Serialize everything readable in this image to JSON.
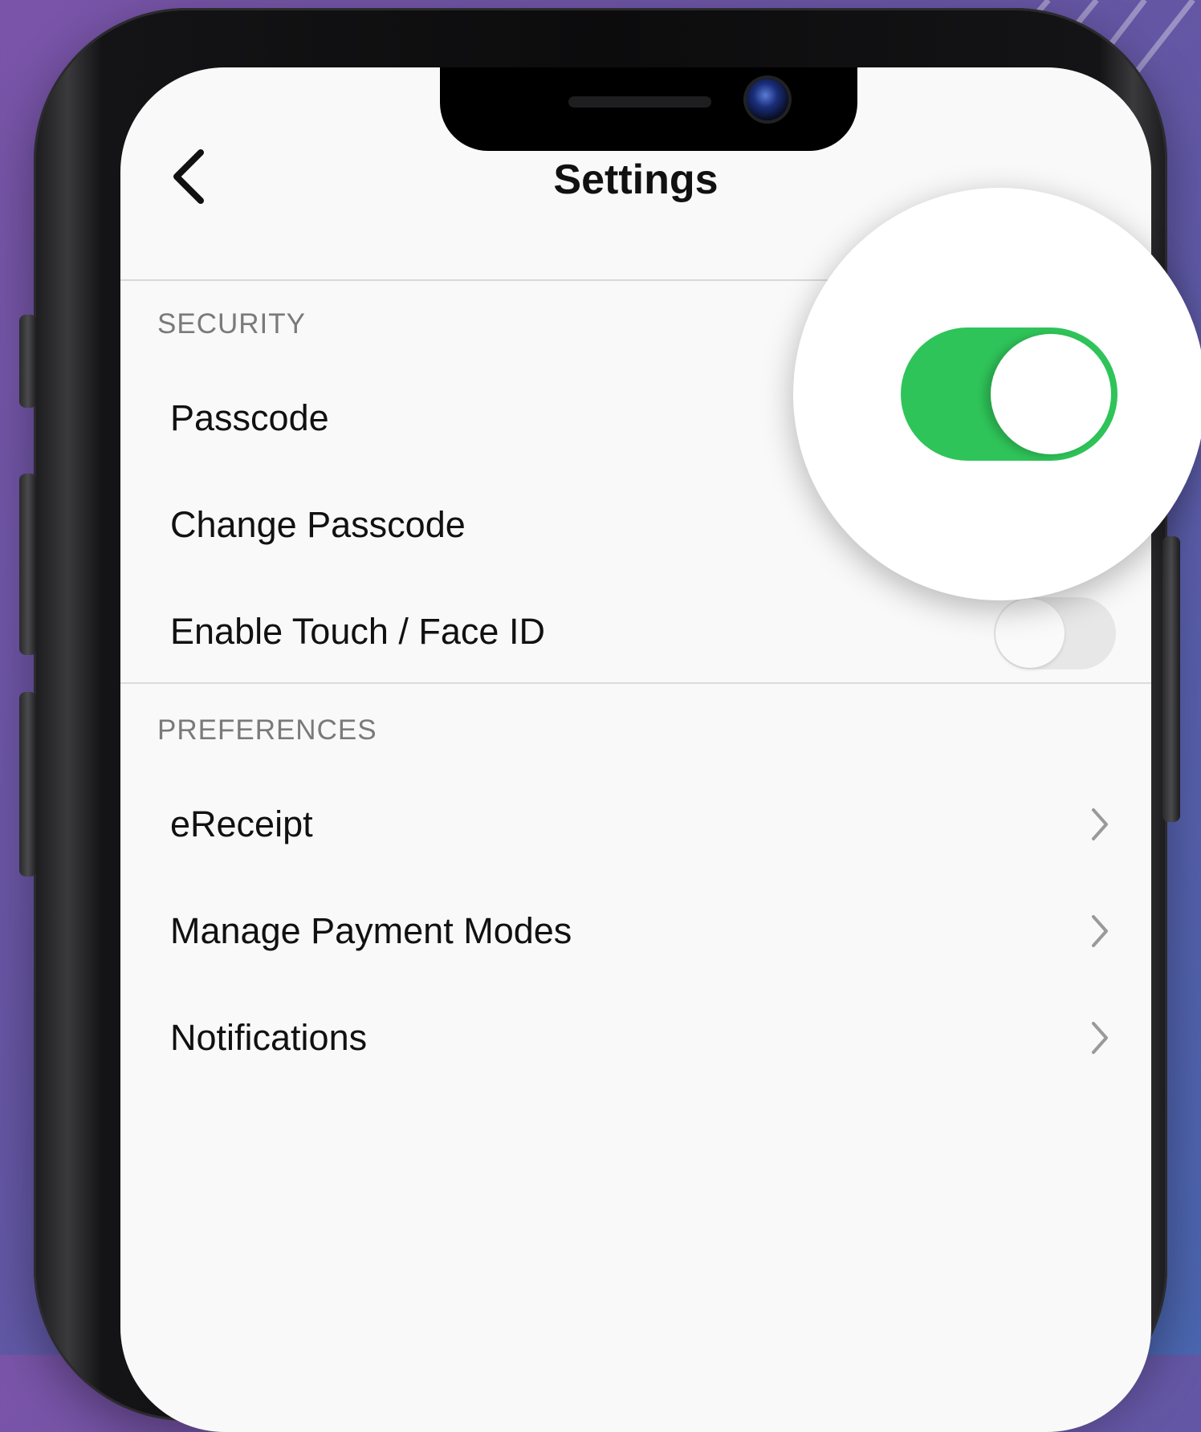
{
  "nav": {
    "title": "Settings",
    "back_icon": "chevron-left-icon"
  },
  "sections": {
    "security": {
      "header": "SECURITY",
      "items": [
        {
          "label": "Passcode"
        },
        {
          "label": "Change Passcode"
        },
        {
          "label": "Enable Touch / Face ID",
          "toggle": "off"
        }
      ]
    },
    "preferences": {
      "header": "PREFERENCES",
      "items": [
        {
          "label": "eReceipt",
          "icon": "chevron-right-icon"
        },
        {
          "label": "Manage Payment Modes",
          "icon": "chevron-right-icon"
        },
        {
          "label": "Notifications",
          "icon": "chevron-right-icon"
        }
      ]
    }
  },
  "magnified_toggle": {
    "state": "on",
    "color": "#2fc459"
  },
  "colors": {
    "background_start": "#7a54a8",
    "background_end": "#4a66b0",
    "toggle_on": "#2fc459",
    "toggle_off": "#e7e7e7",
    "screen_bg": "#f9f9f9"
  }
}
